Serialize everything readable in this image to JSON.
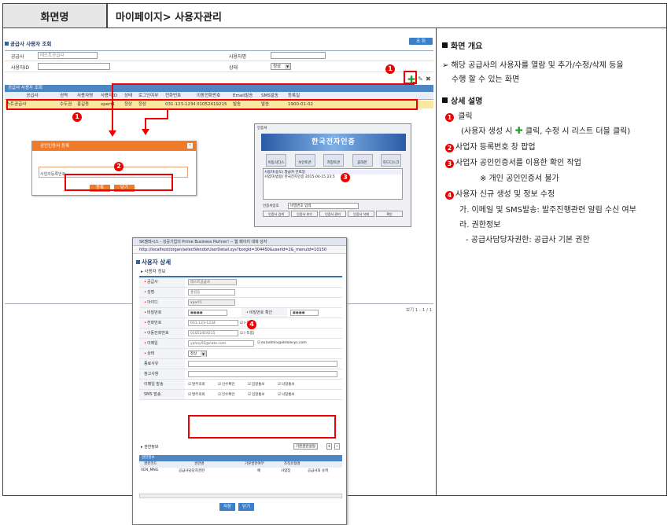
{
  "header": {
    "left": "화면명",
    "right": "마이페이지> 사용자관리"
  },
  "left": {
    "search_title": "공급사 사용자 조회",
    "search_button": "조 회",
    "form": {
      "supplier_label": "공급사",
      "supplier_value": "테스트공급사",
      "user_name_label": "사용자명",
      "user_id_label": "사용자ID",
      "status_label": "상태",
      "status_value": "정상"
    },
    "grid_title": "공급사 사용자 조회",
    "grid_headers": [
      "공급사",
      "권역",
      "사용자명",
      "사용자ID",
      "상태",
      "로그인여부",
      "전화번호",
      "이동전화번호",
      "Email발송",
      "SMS발송",
      "등록일"
    ],
    "grid_row": [
      "스트공급사",
      "수도권",
      "홍길동",
      "xpert1",
      "정상",
      "정상",
      "031-123-1234",
      "01052419215",
      "발송",
      "발송",
      "1900-01-02"
    ],
    "pager": "보기 1 - 1 / 1",
    "badges": [
      "1",
      "1",
      "2",
      "3",
      "4"
    ],
    "popup_cert_reg": {
      "title": "공인인증서 등록",
      "field_label": "사업자등록번호",
      "btn_register": "등록",
      "btn_close": "닫기"
    },
    "popup_cert": {
      "top_label": "인증서",
      "banner": "한국전자인증",
      "icons": [
        "이동식디스크",
        "보안토큰",
        "저장토큰",
        "휴대폰",
        "하드디스크"
      ],
      "list_header": "사용자(용도)   발급자   만료일",
      "list_row": "사업자(범용)  한국전자인증  2015-04-15 23:5",
      "pw_label": "인증서암호",
      "pw_hint": "비밀번호 입력",
      "buttons": [
        "인증서 검색",
        "인증서 보기",
        "인증서 관리",
        "인증서 삭제",
        "확인"
      ]
    },
    "popup_detail": {
      "window_title": "SK텔레시스 - 성공기업의 Prime Business Partner! -- 웹 페이지 대화 상자",
      "url": "http://localhost/organ/selectVendorUserDetail.sys?borgId=304450&userId=2&_menuId=10150",
      "title": "사용자 상세",
      "section": "사용자 정보",
      "fields": {
        "supplier_label": "공급사",
        "supplier_value": "테스트공급사",
        "name_label": "성명",
        "name_value": "홍길동",
        "id_label": "아이디",
        "id_value": "xpert1",
        "pw_label": "비밀번호",
        "pw_value": "●●●●",
        "pw_confirm_label": "비밀번호 확인",
        "pw_confirm_value": "●●●●",
        "tel_label": "전화번호",
        "tel_value": "031-123-1234",
        "tel_hint": "(-포함)",
        "mobile_label": "이동전화번호",
        "mobile_value": "01052419215",
        "mobile_hint": "(-포함)",
        "email_label": "이메일",
        "email_value": "yahey93@nate.com",
        "email_ex": "ex)admin@sktelesys.com",
        "status_label": "상태",
        "status_value": "정상",
        "close_reason_label": "종료사유",
        "note_label": "참고사항",
        "email_send_label": "이메일 발송",
        "sms_send_label": "SMS 발송",
        "checks": [
          "발주의뢰",
          "인수확인",
          "입찰통보",
          "낙찰통보"
        ]
      },
      "auth_section": "권한정보",
      "auth_button": "기본권한설정",
      "auth_bar": "권한정보",
      "auth_headers": [
        "권한코드",
        "권한명",
        "기본권한여부",
        "조직유형명"
      ],
      "auth_row": [
        "VEN_MNG",
        "공급사담당자권한",
        "예",
        "사업장",
        "공급사의 슈퍼"
      ],
      "btn_save": "저장",
      "btn_close": "닫기"
    }
  },
  "right": {
    "overview_title": "화면 개요",
    "overview_line1": "➢ 해당 공급사의 사용자를 열람 및 추가/수정/삭제 등을",
    "overview_line2": "수행 할 수 있는 화면",
    "detail_title": "상세 설명",
    "items": {
      "i1": "클릭",
      "i1_sub_a": "(사용자 생성 시",
      "i1_sub_b": "클릭, 수정 시 리스트 더블 클릭)",
      "i2": "사업자 등록번호 창 팝업",
      "i3": "사업자 공인인증서를 이용한 확인 작업",
      "i3_sub": "※ 개인 공인인증서 불가",
      "i4": "사용자 신규 생성 및 정보 수정",
      "i4_a": "가. 이메일 및 SMS발송: 발주진행관련 알림 수신 여부",
      "i4_b": "라. 권한정보",
      "i4_c": "- 공급사담당자권한: 공급사 기본 권한"
    },
    "badge_numbers": [
      "1",
      "2",
      "3",
      "4"
    ]
  }
}
